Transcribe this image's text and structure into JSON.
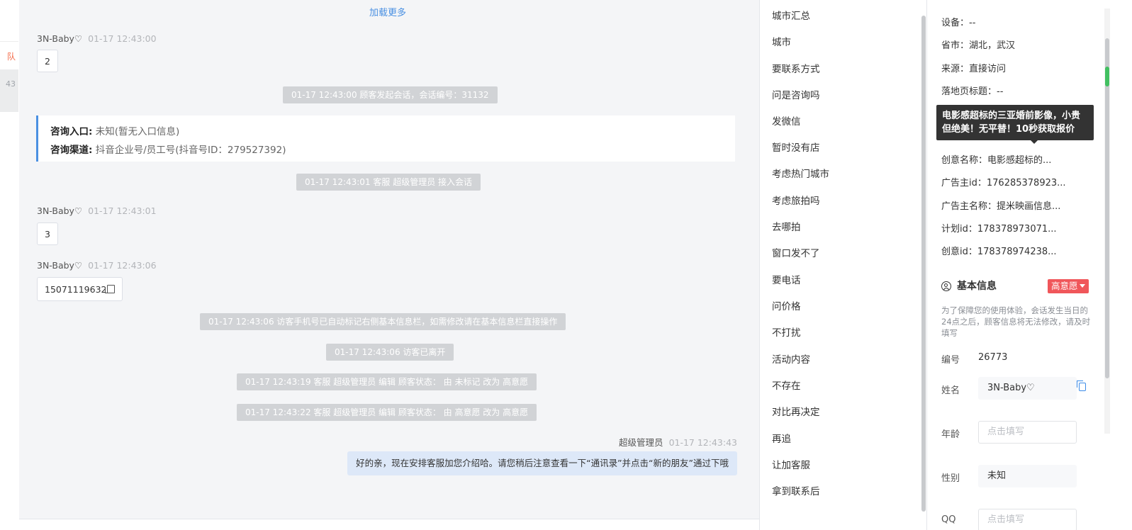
{
  "sidebar": {
    "tab_fragment": "队",
    "active_time_fragment": "43"
  },
  "chat": {
    "load_more": "加载更多",
    "messages": [
      {
        "sender": "3N-Baby♡",
        "time": "01-17 12:43:00",
        "text": "2"
      },
      {
        "sender": "3N-Baby♡",
        "time": "01-17 12:43:01",
        "text": "3"
      },
      {
        "sender": "3N-Baby♡",
        "time": "01-17 12:43:06",
        "text": "15071119632"
      }
    ],
    "system": [
      "01-17 12:43:00 顾客发起会话，会话编号：31132",
      "01-17 12:43:01 客服 超级管理员 接入会话",
      "01-17 12:43:06 访客手机号已自动标记右侧基本信息栏，如需修改请在基本信息栏直接操作",
      "01-17 12:43:06 访客已离开",
      "01-17 12:43:19 客服 超级管理员 编辑 顾客状态： 由 未标记 改为 高意愿",
      "01-17 12:43:22 客服 超级管理员 编辑 顾客状态： 由 高意愿 改为 高意愿"
    ],
    "entry_card": {
      "entry_label": "咨询入口:",
      "entry_value": "未知(暂无入口信息)",
      "channel_label": "咨询渠道:",
      "channel_value": "抖音企业号/员工号(抖音号ID：279527392)"
    },
    "agent": {
      "name": "超级管理员",
      "time": "01-17 12:43:43",
      "text": "好的亲，现在安排客服加您介绍哈。请您稍后注意查看一下“通讯录”并点击“新的朋友”通过下哦"
    }
  },
  "tags": [
    "城市汇总",
    "城市",
    "要联系方式",
    "问是咨询吗",
    "发微信",
    "暂时没有店",
    "考虑热门城市",
    "考虑旅拍吗",
    "去哪拍",
    "窗口发不了",
    "要电话",
    "问价格",
    "不打扰",
    "活动内容",
    "不存在",
    "对比再决定",
    "再追",
    "让加客服",
    "拿到联系后"
  ],
  "info": {
    "rows": [
      {
        "label": "设备：",
        "value": "--"
      },
      {
        "label": "省市：",
        "value": "湖北，武汉"
      },
      {
        "label": "来源：",
        "value": "直接访问"
      },
      {
        "label": "落地页标题：",
        "value": "--"
      },
      {
        "label": "创意名称：",
        "value": "电影感超标的..."
      },
      {
        "label": "广告主id：",
        "value": "176285378923..."
      },
      {
        "label": "广告主名称：",
        "value": "提米映画信息..."
      },
      {
        "label": "计划id：",
        "value": "178378973071..."
      },
      {
        "label": "创意id：",
        "value": "178378974238..."
      }
    ],
    "tooltip": "电影感超标的三亚婚前影像，小贵但绝美！无平替！10秒获取报价",
    "basic_title": "基本信息",
    "intent_badge": "高意愿",
    "notice": "为了保障您的使用体验，会话发生当日的24点之后，顾客信息将无法修改，请及时填写",
    "id_label": "编号",
    "id_value": "26773",
    "name_label": "姓名",
    "name_value": "3N-Baby♡",
    "age_label": "年龄",
    "age_placeholder": "点击填写",
    "gender_label": "性别",
    "gender_value": "未知",
    "qq_label": "QQ",
    "qq_placeholder": "点击填写"
  },
  "colors": {
    "accent": "#4a90e2",
    "badge": "#f0565a",
    "system_bg": "#d1d3d6",
    "agent_bubble": "#dde8f8"
  }
}
